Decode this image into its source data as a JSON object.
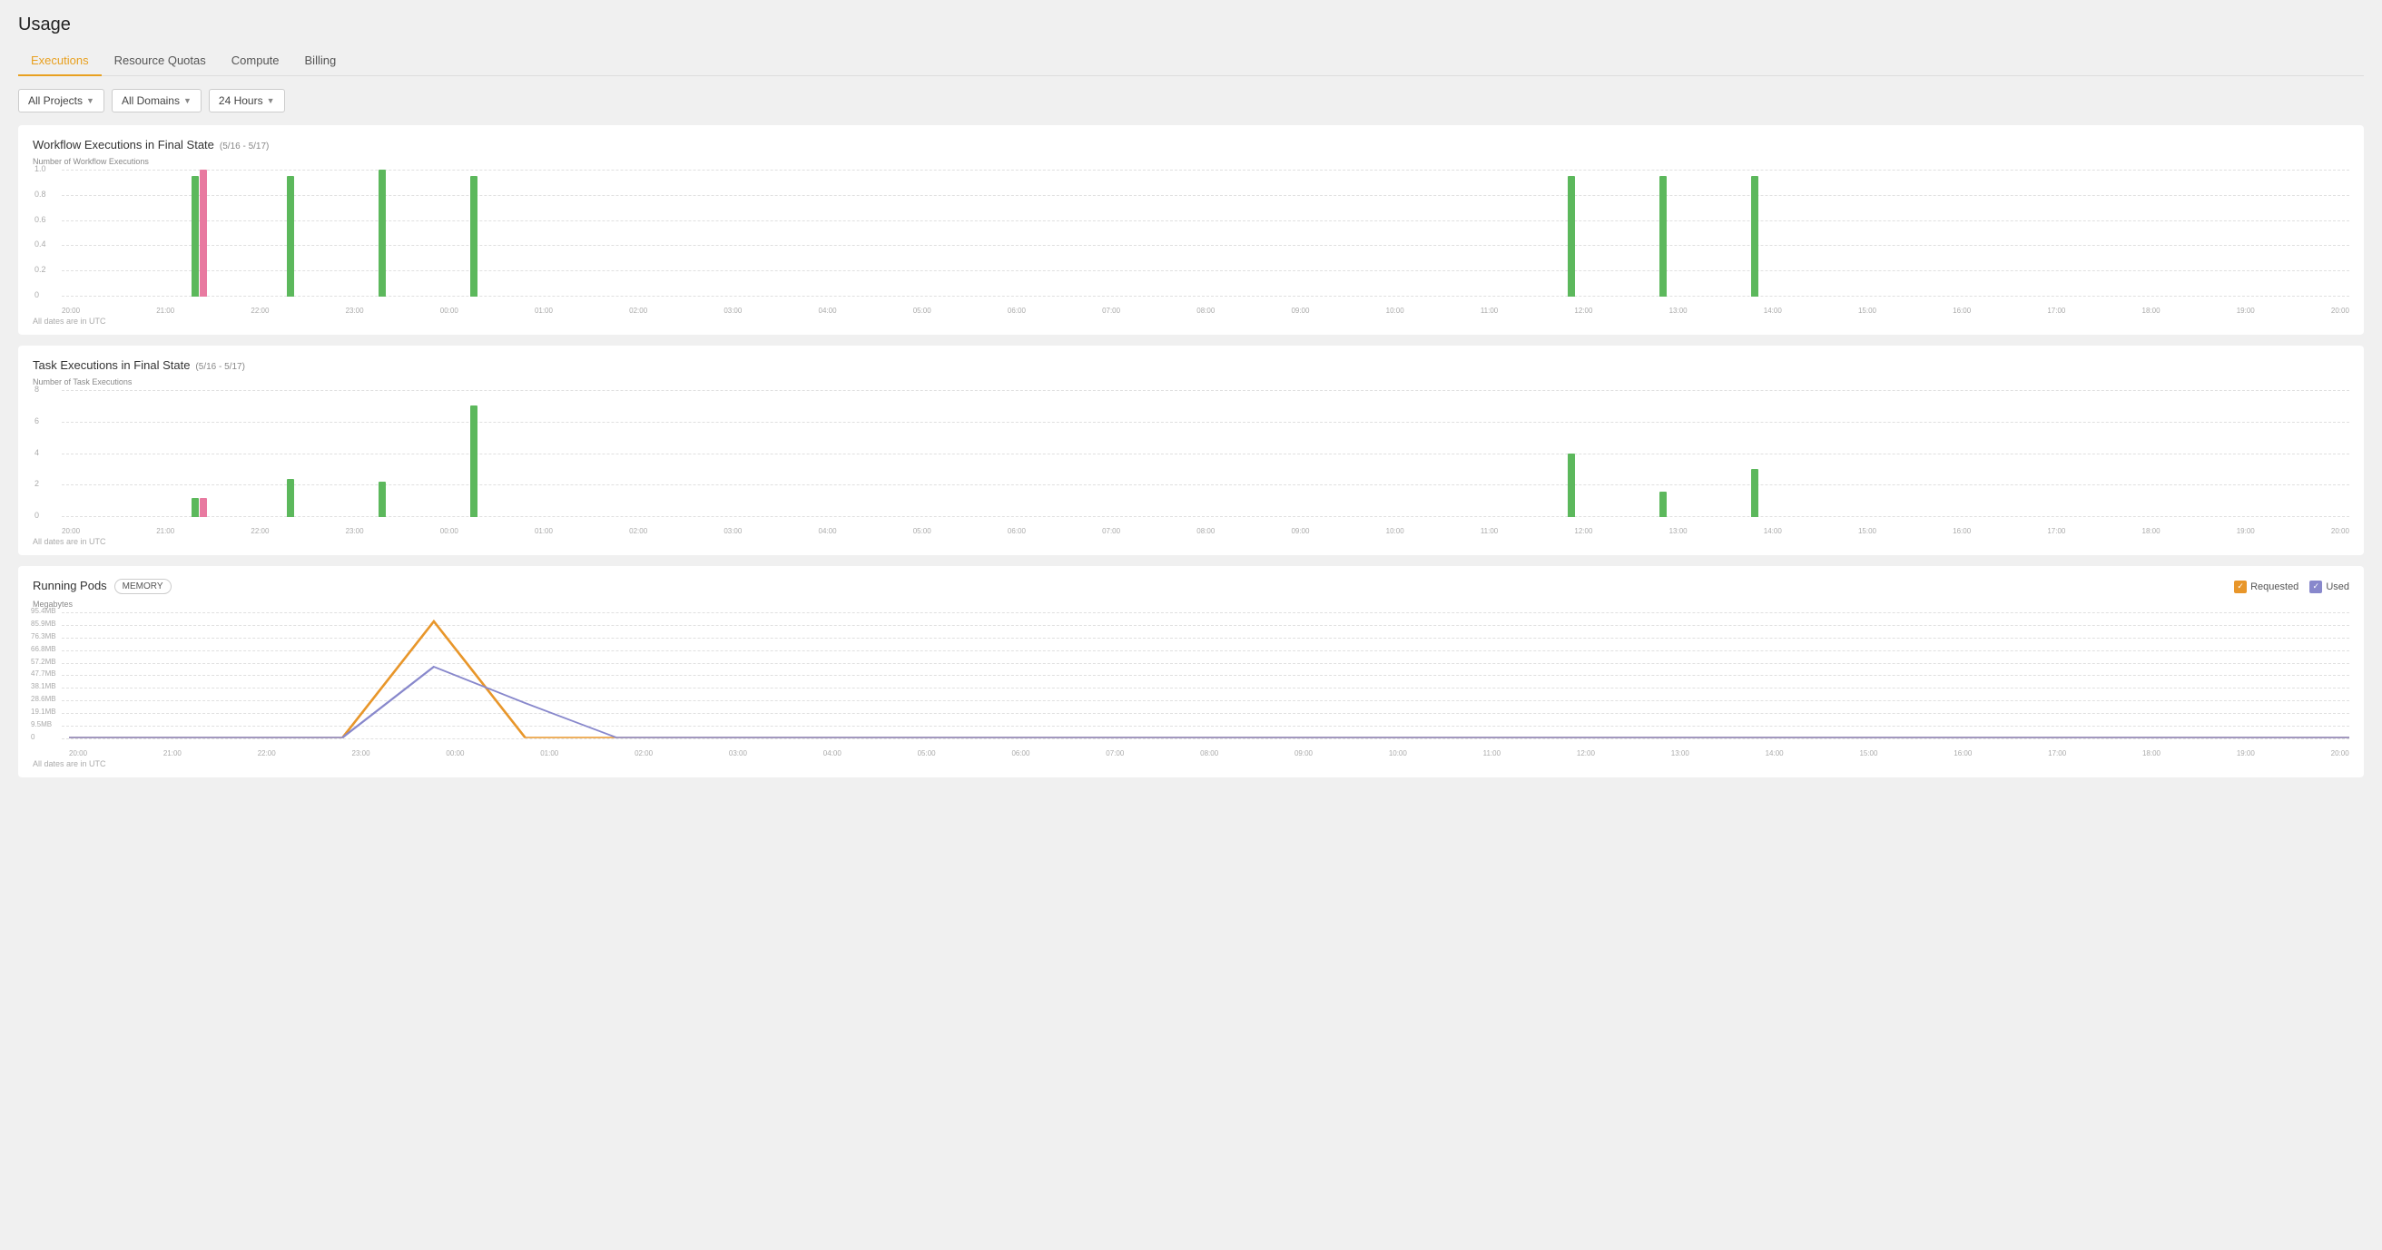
{
  "page": {
    "title": "Usage"
  },
  "tabs": [
    {
      "label": "Executions",
      "active": true
    },
    {
      "label": "Resource Quotas",
      "active": false
    },
    {
      "label": "Compute",
      "active": false
    },
    {
      "label": "Billing",
      "active": false
    }
  ],
  "filters": [
    {
      "label": "All Projects",
      "id": "projects-filter"
    },
    {
      "label": "All Domains",
      "id": "domains-filter"
    },
    {
      "label": "24 Hours",
      "id": "hours-filter"
    }
  ],
  "workflow_chart": {
    "title": "Workflow Executions in Final State",
    "date_range": "(5/16 - 5/17)",
    "y_label": "Number of Workflow Executions",
    "y_ticks": [
      "1.0",
      "0.8",
      "0.6",
      "0.4",
      "0.2",
      "0"
    ],
    "utc_note": "All dates are in UTC",
    "x_labels": [
      "20:00",
      "21:00",
      "22:00",
      "23:00",
      "00:00",
      "01:00",
      "02:00",
      "03:00",
      "04:00",
      "05:00",
      "06:00",
      "07:00",
      "08:00",
      "09:00",
      "10:00",
      "11:00",
      "12:00",
      "13:00",
      "14:00",
      "15:00",
      "16:00",
      "17:00",
      "18:00",
      "19:00",
      "20:00"
    ],
    "bars": [
      {
        "pos": 0,
        "green": 0,
        "pink": 0
      },
      {
        "pos": 1,
        "green": 95,
        "pink": 100
      },
      {
        "pos": 2,
        "green": 95,
        "pink": 0
      },
      {
        "pos": 3,
        "green": 100,
        "pink": 0
      },
      {
        "pos": 4,
        "green": 95,
        "pink": 0
      },
      {
        "pos": 5,
        "green": 0,
        "pink": 0
      },
      {
        "pos": 6,
        "green": 0,
        "pink": 0
      },
      {
        "pos": 7,
        "green": 0,
        "pink": 0
      },
      {
        "pos": 8,
        "green": 0,
        "pink": 0
      },
      {
        "pos": 9,
        "green": 0,
        "pink": 0
      },
      {
        "pos": 10,
        "green": 0,
        "pink": 0
      },
      {
        "pos": 11,
        "green": 0,
        "pink": 0
      },
      {
        "pos": 12,
        "green": 0,
        "pink": 0
      },
      {
        "pos": 13,
        "green": 0,
        "pink": 0
      },
      {
        "pos": 14,
        "green": 0,
        "pink": 0
      },
      {
        "pos": 15,
        "green": 0,
        "pink": 0
      },
      {
        "pos": 16,
        "green": 95,
        "pink": 0
      },
      {
        "pos": 17,
        "green": 95,
        "pink": 0
      },
      {
        "pos": 18,
        "green": 95,
        "pink": 0
      },
      {
        "pos": 19,
        "green": 0,
        "pink": 0
      },
      {
        "pos": 20,
        "green": 0,
        "pink": 0
      },
      {
        "pos": 21,
        "green": 0,
        "pink": 0
      },
      {
        "pos": 22,
        "green": 0,
        "pink": 0
      },
      {
        "pos": 23,
        "green": 0,
        "pink": 0
      },
      {
        "pos": 24,
        "green": 0,
        "pink": 0
      }
    ]
  },
  "task_chart": {
    "title": "Task Executions in Final State",
    "date_range": "(5/16 - 5/17)",
    "y_label": "Number of Task Executions",
    "y_ticks": [
      "8",
      "6",
      "4",
      "2",
      "0"
    ],
    "utc_note": "All dates are in UTC",
    "x_labels": [
      "20:00",
      "21:00",
      "22:00",
      "23:00",
      "00:00",
      "01:00",
      "02:00",
      "03:00",
      "04:00",
      "05:00",
      "06:00",
      "07:00",
      "08:00",
      "09:00",
      "10:00",
      "11:00",
      "12:00",
      "13:00",
      "14:00",
      "15:00",
      "16:00",
      "17:00",
      "18:00",
      "19:00",
      "20:00"
    ],
    "bars": [
      {
        "pos": 0,
        "green": 0,
        "pink": 0
      },
      {
        "pos": 1,
        "green": 15,
        "pink": 15
      },
      {
        "pos": 2,
        "green": 30,
        "pink": 0
      },
      {
        "pos": 3,
        "green": 28,
        "pink": 0
      },
      {
        "pos": 4,
        "green": 88,
        "pink": 0
      },
      {
        "pos": 5,
        "green": 0,
        "pink": 0
      },
      {
        "pos": 6,
        "green": 0,
        "pink": 0
      },
      {
        "pos": 7,
        "green": 0,
        "pink": 0
      },
      {
        "pos": 8,
        "green": 0,
        "pink": 0
      },
      {
        "pos": 9,
        "green": 0,
        "pink": 0
      },
      {
        "pos": 10,
        "green": 0,
        "pink": 0
      },
      {
        "pos": 11,
        "green": 0,
        "pink": 0
      },
      {
        "pos": 12,
        "green": 0,
        "pink": 0
      },
      {
        "pos": 13,
        "green": 0,
        "pink": 0
      },
      {
        "pos": 14,
        "green": 0,
        "pink": 0
      },
      {
        "pos": 15,
        "green": 0,
        "pink": 0
      },
      {
        "pos": 16,
        "green": 50,
        "pink": 0
      },
      {
        "pos": 17,
        "green": 20,
        "pink": 0
      },
      {
        "pos": 18,
        "green": 38,
        "pink": 0
      },
      {
        "pos": 19,
        "green": 0,
        "pink": 0
      },
      {
        "pos": 20,
        "green": 0,
        "pink": 0
      },
      {
        "pos": 21,
        "green": 0,
        "pink": 0
      },
      {
        "pos": 22,
        "green": 0,
        "pink": 0
      },
      {
        "pos": 23,
        "green": 0,
        "pink": 0
      },
      {
        "pos": 24,
        "green": 0,
        "pink": 0
      }
    ]
  },
  "running_pods": {
    "title": "Running Pods",
    "memory_label": "MEMORY",
    "y_label": "Megabytes",
    "y_ticks": [
      "95.4MB",
      "85.9MB",
      "76.3MB",
      "66.8MB",
      "57.2MB",
      "47.7MB",
      "38.1MB",
      "28.6MB",
      "19.1MB",
      "9.5MB",
      "0"
    ],
    "utc_note": "All dates are in UTC",
    "legend_requested": "Requested",
    "legend_used": "Used",
    "x_labels": [
      "20:00",
      "21:00",
      "22:00",
      "23:00",
      "00:00",
      "01:00",
      "02:00",
      "03:00",
      "04:00",
      "05:00",
      "06:00",
      "07:00",
      "08:00",
      "09:00",
      "10:00",
      "11:00",
      "12:00",
      "13:00",
      "14:00",
      "15:00",
      "16:00",
      "17:00",
      "18:00",
      "19:00",
      "20:00"
    ]
  }
}
